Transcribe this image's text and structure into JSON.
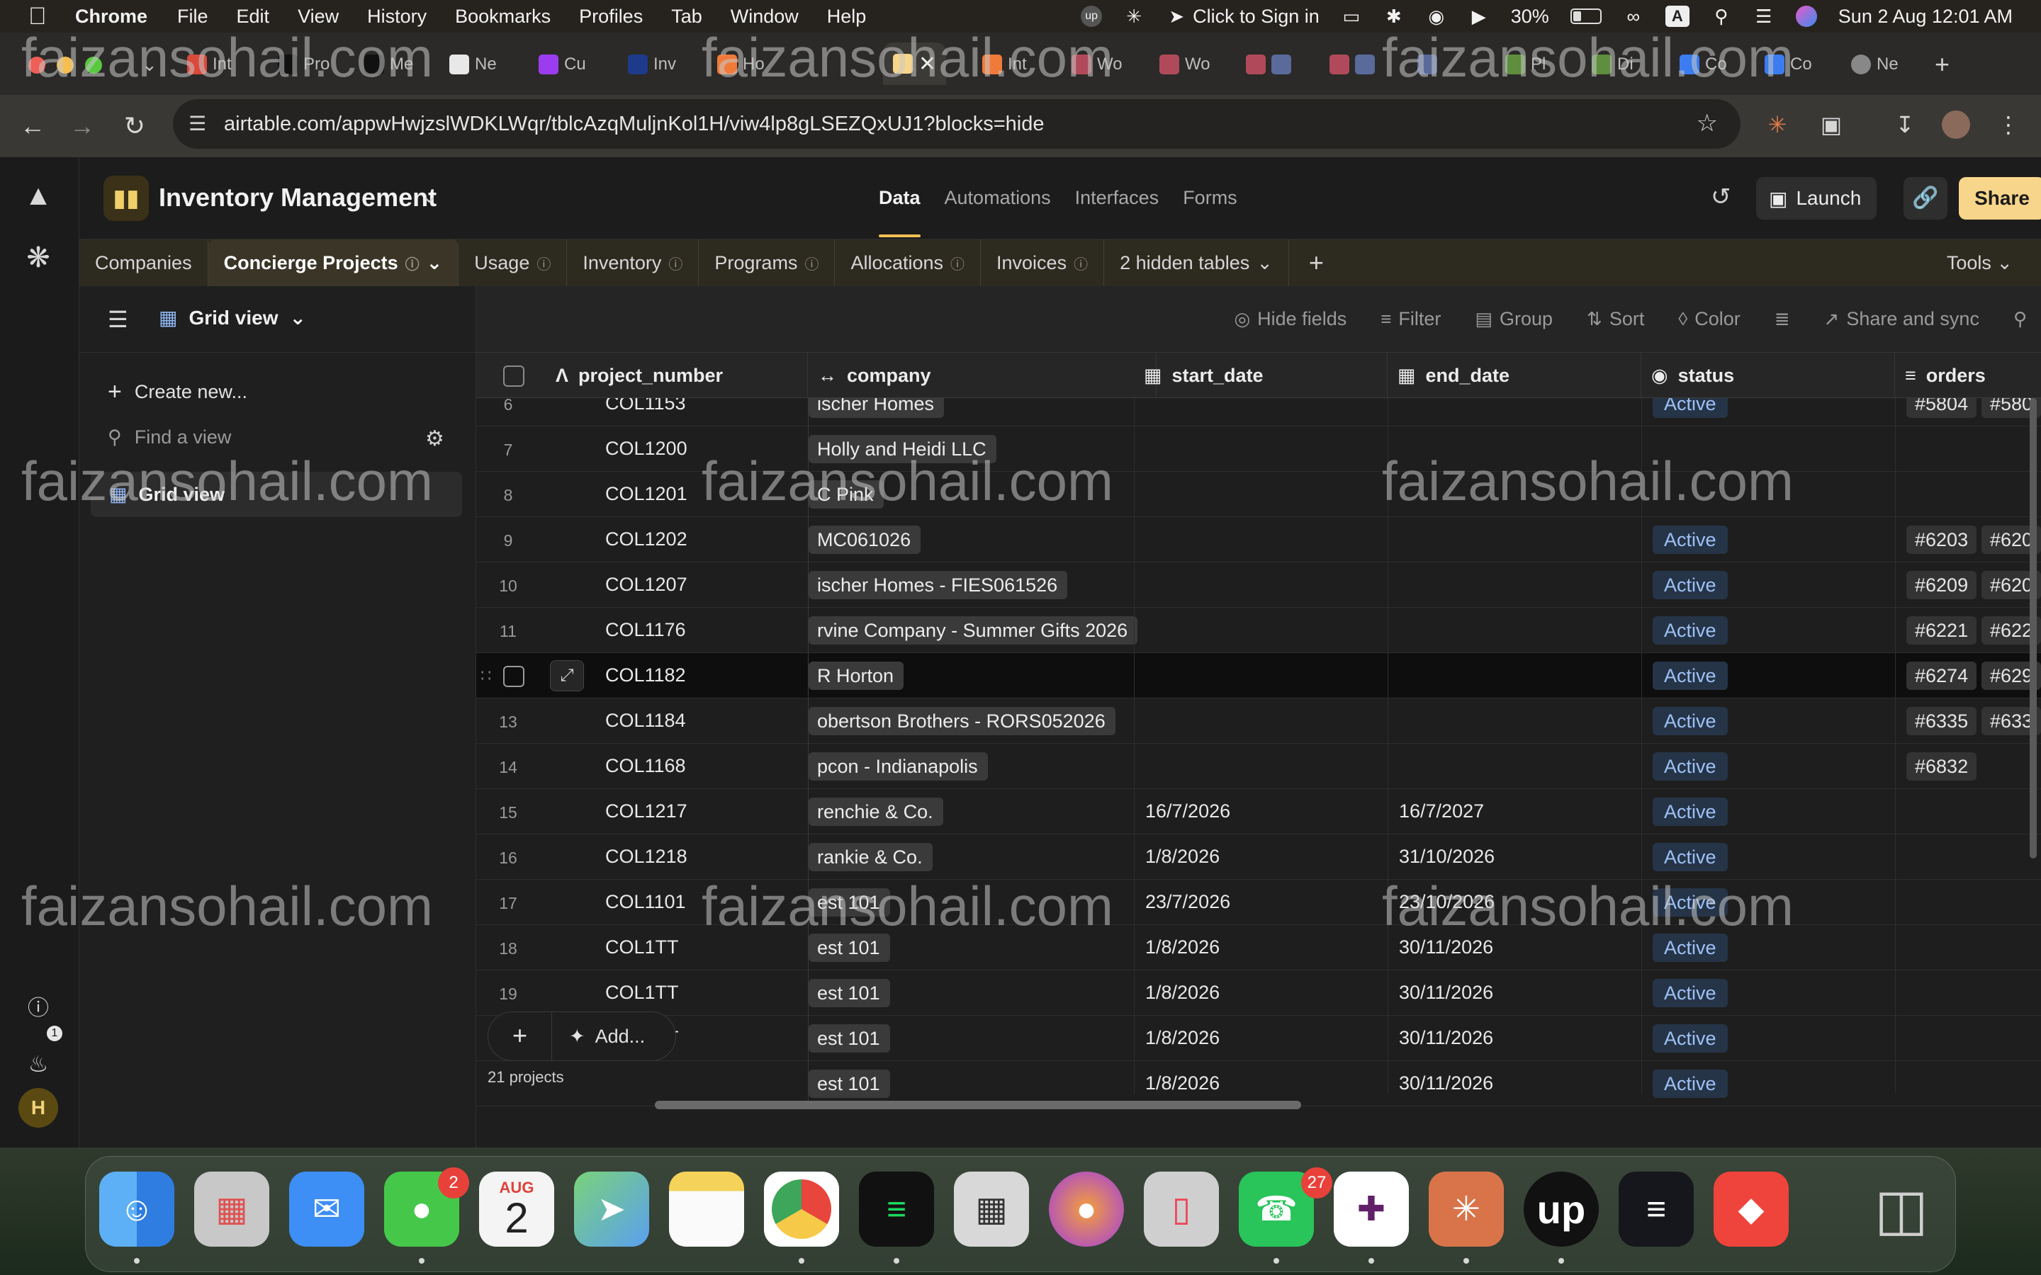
{
  "menubar": {
    "app": "Chrome",
    "items": [
      "File",
      "Edit",
      "View",
      "History",
      "Bookmarks",
      "Profiles",
      "Tab",
      "Window",
      "Help"
    ],
    "click_to_sign_in": "Click to Sign in",
    "battery": "30%",
    "input_source": "A",
    "datetime": "Sun 2 Aug  12:01 AM"
  },
  "tabs": [
    {
      "label": "Int"
    },
    {
      "label": "Pro"
    },
    {
      "label": "Me"
    },
    {
      "label": "Ne"
    },
    {
      "label": "Cu"
    },
    {
      "label": "Inv"
    },
    {
      "label": "Ho"
    },
    {
      "label": "Int"
    },
    {
      "label": "Wo"
    },
    {
      "label": "Wo"
    },
    {
      "label": "Pl"
    },
    {
      "label": "Di"
    },
    {
      "label": "Co"
    },
    {
      "label": "Co"
    },
    {
      "label": "Ne"
    }
  ],
  "url": "airtable.com/appwHwjzslWDKLWqr/tblcAzqMuljnKol1H/viw4lp8gLSEZQxUJ1?blocks=hide",
  "base": {
    "title": "Inventory Management",
    "nav": [
      "Data",
      "Automations",
      "Interfaces",
      "Forms"
    ],
    "active_nav": "Data",
    "launch": "Launch",
    "share": "Share"
  },
  "tables": [
    "Companies",
    "Concierge Projects",
    "Usage",
    "Inventory",
    "Programs",
    "Allocations",
    "Invoices"
  ],
  "active_table": "Concierge Projects",
  "hidden_tables": "2 hidden tables",
  "tools": "Tools",
  "view": {
    "name": "Grid view",
    "create_new": "Create new...",
    "find_placeholder": "Find a view",
    "sidebar_view": "Grid view"
  },
  "toolbar": {
    "hide_fields": "Hide fields",
    "filter": "Filter",
    "group": "Group",
    "sort": "Sort",
    "color": "Color",
    "share_sync": "Share and sync"
  },
  "columns": [
    "project_number",
    "company",
    "start_date",
    "end_date",
    "status",
    "orders"
  ],
  "rows": [
    {
      "n": "6",
      "pn": "COL1153",
      "company": "ischer Homes",
      "sd": "",
      "ed": "",
      "status": "Active",
      "orders": [
        "#5804",
        "#580"
      ]
    },
    {
      "n": "7",
      "pn": "COL1200",
      "company": "Holly and Heidi LLC",
      "sd": "",
      "ed": "",
      "status": "",
      "orders": []
    },
    {
      "n": "8",
      "pn": "COL1201",
      "company": "C Pink",
      "sd": "",
      "ed": "",
      "status": "",
      "orders": []
    },
    {
      "n": "9",
      "pn": "COL1202",
      "company": "MC061026",
      "sd": "",
      "ed": "",
      "status": "Active",
      "orders": [
        "#6203",
        "#620"
      ]
    },
    {
      "n": "10",
      "pn": "COL1207",
      "company": "ischer Homes - FIES061526",
      "sd": "",
      "ed": "",
      "status": "Active",
      "orders": [
        "#6209",
        "#620"
      ]
    },
    {
      "n": "11",
      "pn": "COL1176",
      "company": "rvine Company - Summer Gifts 2026",
      "sd": "",
      "ed": "",
      "status": "Active",
      "orders": [
        "#6221",
        "#622"
      ]
    },
    {
      "n": "",
      "pn": "COL1182",
      "company": "R Horton",
      "sd": "",
      "ed": "",
      "status": "Active",
      "orders": [
        "#6274",
        "#629"
      ]
    },
    {
      "n": "13",
      "pn": "COL1184",
      "company": "obertson Brothers - RORS052026",
      "sd": "",
      "ed": "",
      "status": "Active",
      "orders": [
        "#6335",
        "#633"
      ]
    },
    {
      "n": "14",
      "pn": "COL1168",
      "company": "pcon - Indianapolis",
      "sd": "",
      "ed": "",
      "status": "Active",
      "orders": [
        "#6832"
      ]
    },
    {
      "n": "15",
      "pn": "COL1217",
      "company": "renchie & Co.",
      "sd": "16/7/2026",
      "ed": "16/7/2027",
      "status": "Active",
      "orders": []
    },
    {
      "n": "16",
      "pn": "COL1218",
      "company": "rankie & Co.",
      "sd": "1/8/2026",
      "ed": "31/10/2026",
      "status": "Active",
      "orders": []
    },
    {
      "n": "17",
      "pn": "COL1101",
      "company": "est 101",
      "sd": "23/7/2026",
      "ed": "23/10/2026",
      "status": "Active",
      "orders": []
    },
    {
      "n": "18",
      "pn": "COL1TT",
      "company": "est 101",
      "sd": "1/8/2026",
      "ed": "30/11/2026",
      "status": "Active",
      "orders": []
    },
    {
      "n": "19",
      "pn": "COL1TT",
      "company": "est 101",
      "sd": "1/8/2026",
      "ed": "30/11/2026",
      "status": "Active",
      "orders": []
    },
    {
      "n": "20",
      "pn": "COL1TT",
      "company": "est 101",
      "sd": "1/8/2026",
      "ed": "30/11/2026",
      "status": "Active",
      "orders": []
    },
    {
      "n": "",
      "pn": "",
      "company": "est 101",
      "sd": "1/8/2026",
      "ed": "30/11/2026",
      "status": "Active",
      "orders": []
    }
  ],
  "add_label": "Add...",
  "record_count": "21 projects",
  "rail": {
    "avatar": "H",
    "notifications": "1"
  },
  "dock": {
    "calendar_month": "AUG",
    "calendar_day": "2",
    "messages_badge": "2",
    "whatsapp_badge": "27"
  },
  "watermark": "faizansohail.com"
}
